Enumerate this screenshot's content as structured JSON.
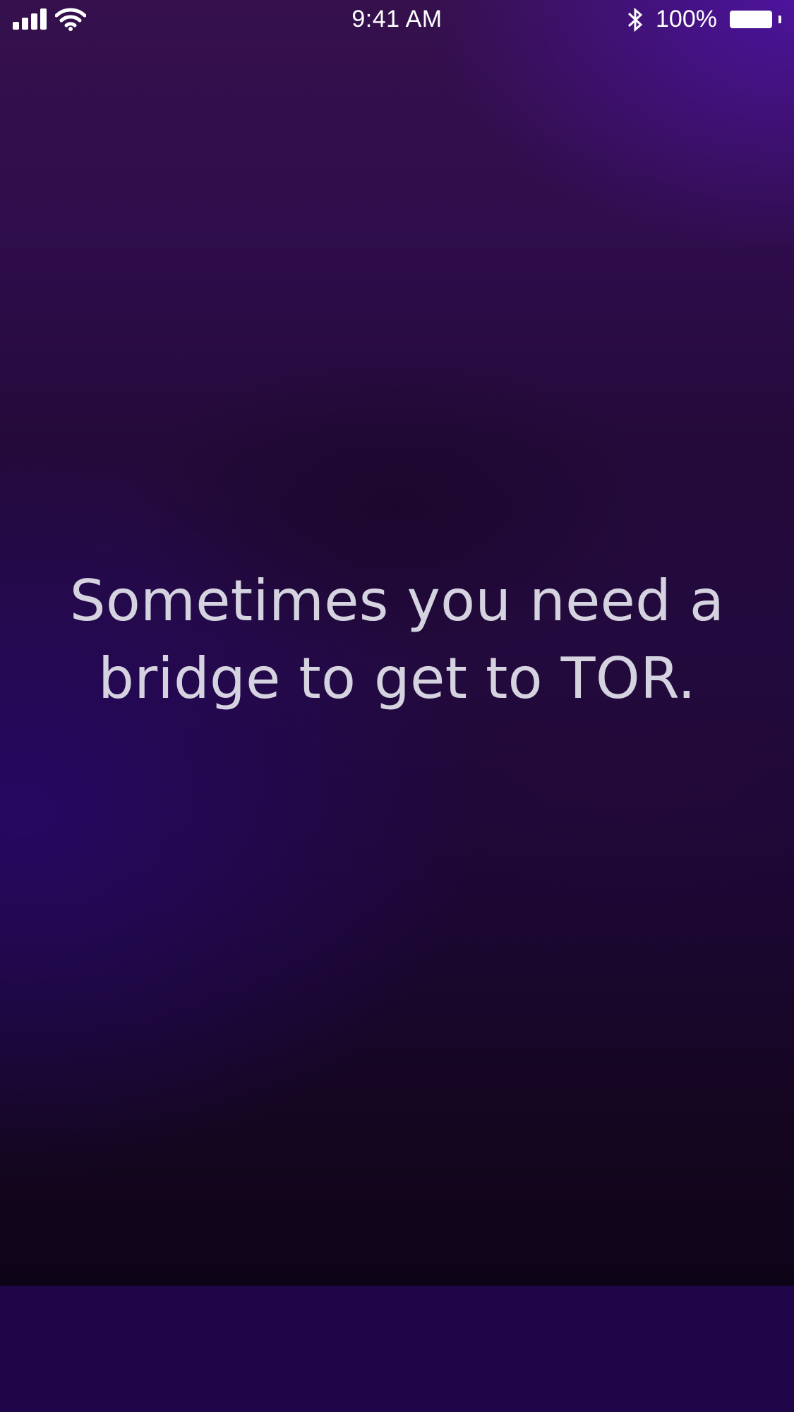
{
  "status_bar": {
    "time": "9:41 AM",
    "battery_percent": "100%",
    "battery_level": 1.0,
    "signal_bars": 4,
    "icons": [
      "signal-icon",
      "wifi-icon",
      "bluetooth-icon",
      "battery-icon"
    ]
  },
  "hero": {
    "headline_line1": "Sometimes you need a",
    "headline_line2": "bridge to get to TOR."
  },
  "colors": {
    "text": "#d6d3e0",
    "background_top": "#35104c",
    "background_bottom": "#0e0418",
    "bottom_band": "#1e0648"
  }
}
